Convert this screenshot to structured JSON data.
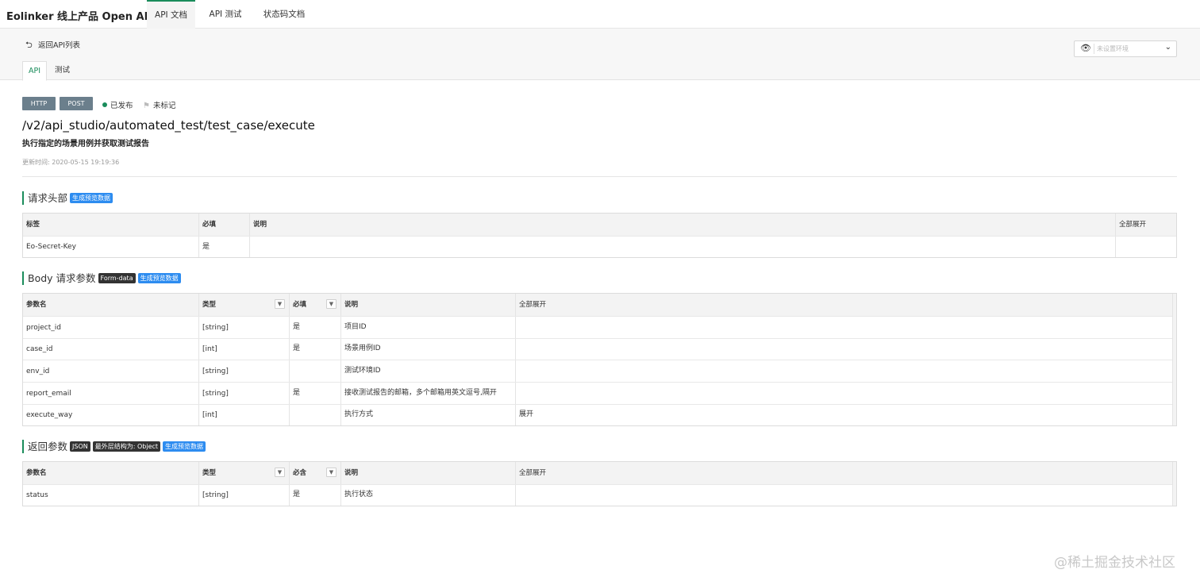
{
  "app": {
    "title": "Eolinker 线上产品 Open API..."
  },
  "top_tabs": [
    {
      "label": "API 文档",
      "active": true
    },
    {
      "label": "API 测试",
      "active": false
    },
    {
      "label": "状态码文档",
      "active": false
    }
  ],
  "subheader": {
    "back_label": "返回API列表",
    "env_placeholder": "未设置环境",
    "tabs": [
      {
        "label": "API",
        "active": true
      },
      {
        "label": "测试",
        "active": false
      }
    ]
  },
  "api": {
    "protocol": "HTTP",
    "method": "POST",
    "status": "已发布",
    "mark": "未标记",
    "path": "/v2/api_studio/automated_test/test_case/execute",
    "description": "执行指定的场景用例并获取测试报告",
    "updated": "更新时间:  2020-05-15 19:19:36"
  },
  "headers_section": {
    "title": "请求头部",
    "preview_tag": "生成预览数据",
    "columns": [
      "标签",
      "必填",
      "说明"
    ],
    "expand_all": "全部展开",
    "rows": [
      {
        "name": "Eo-Secret-Key",
        "required": "是",
        "desc": ""
      }
    ]
  },
  "body_section": {
    "title": "Body 请求参数",
    "format_tag": "Form-data",
    "preview_tag": "生成预览数据",
    "columns": [
      "参数名",
      "类型",
      "必填",
      "说明"
    ],
    "expand_all": "全部展开",
    "rows": [
      {
        "name": "project_id",
        "type": "[string]",
        "required": "是",
        "desc": "项目ID",
        "extra": ""
      },
      {
        "name": "case_id",
        "type": "[int]",
        "required": "是",
        "desc": "场景用例ID",
        "extra": ""
      },
      {
        "name": "env_id",
        "type": "[string]",
        "required": "",
        "desc": "测试环境ID",
        "extra": ""
      },
      {
        "name": "report_email",
        "type": "[string]",
        "required": "是",
        "desc": "接收测试报告的邮箱，多个邮箱用英文逗号,隔开",
        "extra": ""
      },
      {
        "name": "execute_way",
        "type": "[int]",
        "required": "",
        "desc": "执行方式",
        "extra": "展开"
      }
    ]
  },
  "response_section": {
    "title": "返回参数",
    "format_tag": "JSON",
    "structure_tag": "最外层结构为:  Object",
    "preview_tag": "生成预览数据",
    "columns": [
      "参数名",
      "类型",
      "必含",
      "说明"
    ],
    "expand_all": "全部展开",
    "rows": [
      {
        "name": "status",
        "type": "[string]",
        "required": "是",
        "desc": "执行状态"
      }
    ]
  },
  "watermark": "@稀土掘金技术社区",
  "colors": {
    "accent": "#1a8c5b",
    "link": "#2d8cf0",
    "pill": "#6b7f8c"
  }
}
